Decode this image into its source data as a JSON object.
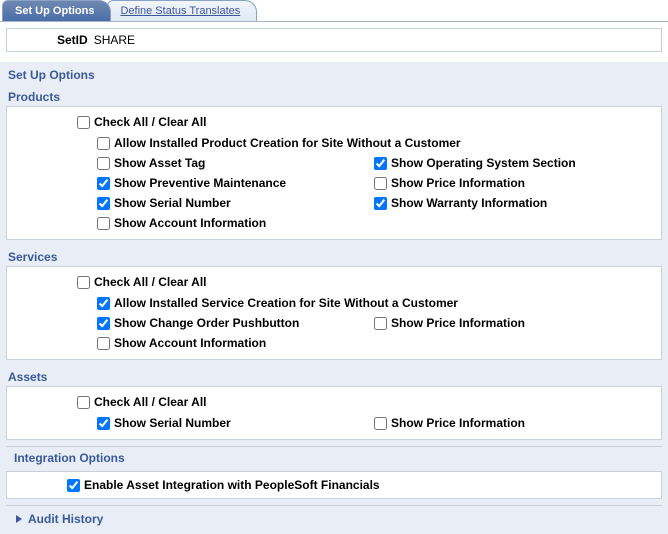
{
  "tabs": {
    "active": "Set Up Options",
    "inactive": "Define Status Translates"
  },
  "setid": {
    "label": "SetID",
    "value": "SHARE"
  },
  "sectionTitle": "Set Up Options",
  "products": {
    "title": "Products",
    "checkAll": "Check All / Clear All",
    "allowInstalled": "Allow Installed Product Creation for Site Without a Customer",
    "showAssetTag": "Show Asset Tag",
    "showOS": "Show Operating System Section",
    "showPM": "Show Preventive Maintenance",
    "showPrice": "Show Price Information",
    "showSerial": "Show Serial Number",
    "showWarranty": "Show Warranty Information",
    "showAccount": "Show Account Information"
  },
  "services": {
    "title": "Services",
    "checkAll": "Check All / Clear All",
    "allowInstalled": "Allow Installed Service Creation for Site Without a Customer",
    "showChangeOrder": "Show Change Order Pushbutton",
    "showPrice": "Show Price Information",
    "showAccount": "Show Account Information"
  },
  "assets": {
    "title": "Assets",
    "checkAll": "Check All / Clear All",
    "showSerial": "Show Serial Number",
    "showPrice": "Show Price Information"
  },
  "integration": {
    "title": "Integration Options",
    "enable": "Enable Asset Integration with PeopleSoft Financials"
  },
  "audit": "Audit History",
  "checked": {
    "products": {
      "checkAll": false,
      "allowInstalled": false,
      "showAssetTag": false,
      "showOS": true,
      "showPM": true,
      "showPrice": false,
      "showSerial": true,
      "showWarranty": true,
      "showAccount": false
    },
    "services": {
      "checkAll": false,
      "allowInstalled": true,
      "showChangeOrder": true,
      "showPrice": false,
      "showAccount": false
    },
    "assets": {
      "checkAll": false,
      "showSerial": true,
      "showPrice": false
    },
    "integration": {
      "enable": true
    }
  }
}
